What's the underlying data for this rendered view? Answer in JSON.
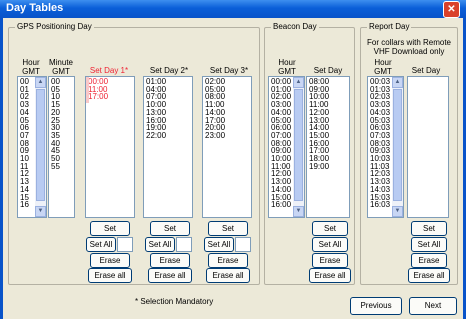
{
  "window": {
    "title": "Day Tables",
    "close_glyph": "✕"
  },
  "gps": {
    "legend": "GPS Positioning Day",
    "hour_head": "Hour\nGMT",
    "minute_head": "Minute\nGMT",
    "day1_head": "Set Day 1*",
    "day2_head": "Set Day 2*",
    "day3_head": "Set Day 3*",
    "hours": [
      "00",
      "01",
      "02",
      "03",
      "04",
      "05",
      "06",
      "07",
      "08",
      "09",
      "10",
      "11",
      "12",
      "13",
      "14",
      "15",
      "16"
    ],
    "minutes": [
      "00",
      "05",
      "10",
      "15",
      "20",
      "25",
      "30",
      "35",
      "40",
      "45",
      "50",
      "55"
    ],
    "day1": [
      "00:00",
      "11:00",
      "17:00"
    ],
    "day2": [
      "01:00",
      "04:00",
      "07:00",
      "10:00",
      "13:00",
      "16:00",
      "19:00",
      "22:00"
    ],
    "day3": [
      "02:00",
      "05:00",
      "08:00",
      "11:00",
      "14:00",
      "17:00",
      "20:00",
      "23:00"
    ],
    "set_label": "Set",
    "set_all_label": "Set All",
    "erase_label": "Erase",
    "erase_all_label": "Erase all",
    "mandatory_note": "* Selection Mandatory"
  },
  "beacon": {
    "legend": "Beacon Day",
    "hour_head": "Hour\nGMT",
    "set_head": "Set Day",
    "hours": [
      "00:00",
      "01:00",
      "02:00",
      "03:00",
      "04:00",
      "05:00",
      "06:00",
      "07:00",
      "08:00",
      "09:00",
      "10:00",
      "11:00",
      "12:00",
      "13:00",
      "14:00",
      "15:00",
      "16:00"
    ],
    "set": [
      "08:00",
      "09:00",
      "10:00",
      "11:00",
      "12:00",
      "13:00",
      "14:00",
      "15:00",
      "16:00",
      "17:00",
      "18:00",
      "19:00"
    ],
    "set_label": "Set",
    "set_all_label": "Set All",
    "erase_label": "Erase",
    "erase_all_label": "Erase all"
  },
  "report": {
    "legend": "Report Day",
    "note": "For collars with Remote\nVHF Download only",
    "hour_head": "Hour\nGMT",
    "set_head": "Set Day",
    "hours": [
      "00:03",
      "01:03",
      "02:03",
      "03:03",
      "04:03",
      "05:03",
      "06:03",
      "07:03",
      "08:03",
      "09:03",
      "10:03",
      "11:03",
      "12:03",
      "13:03",
      "14:03",
      "15:03",
      "16:03"
    ],
    "set_label": "Set",
    "set_all_label": "Set All",
    "erase_label": "Erase",
    "erase_all_label": "Erase all"
  },
  "nav": {
    "previous_label": "Previous",
    "next_label": "Next"
  },
  "icons": {
    "up": "▲",
    "down": "▼"
  }
}
